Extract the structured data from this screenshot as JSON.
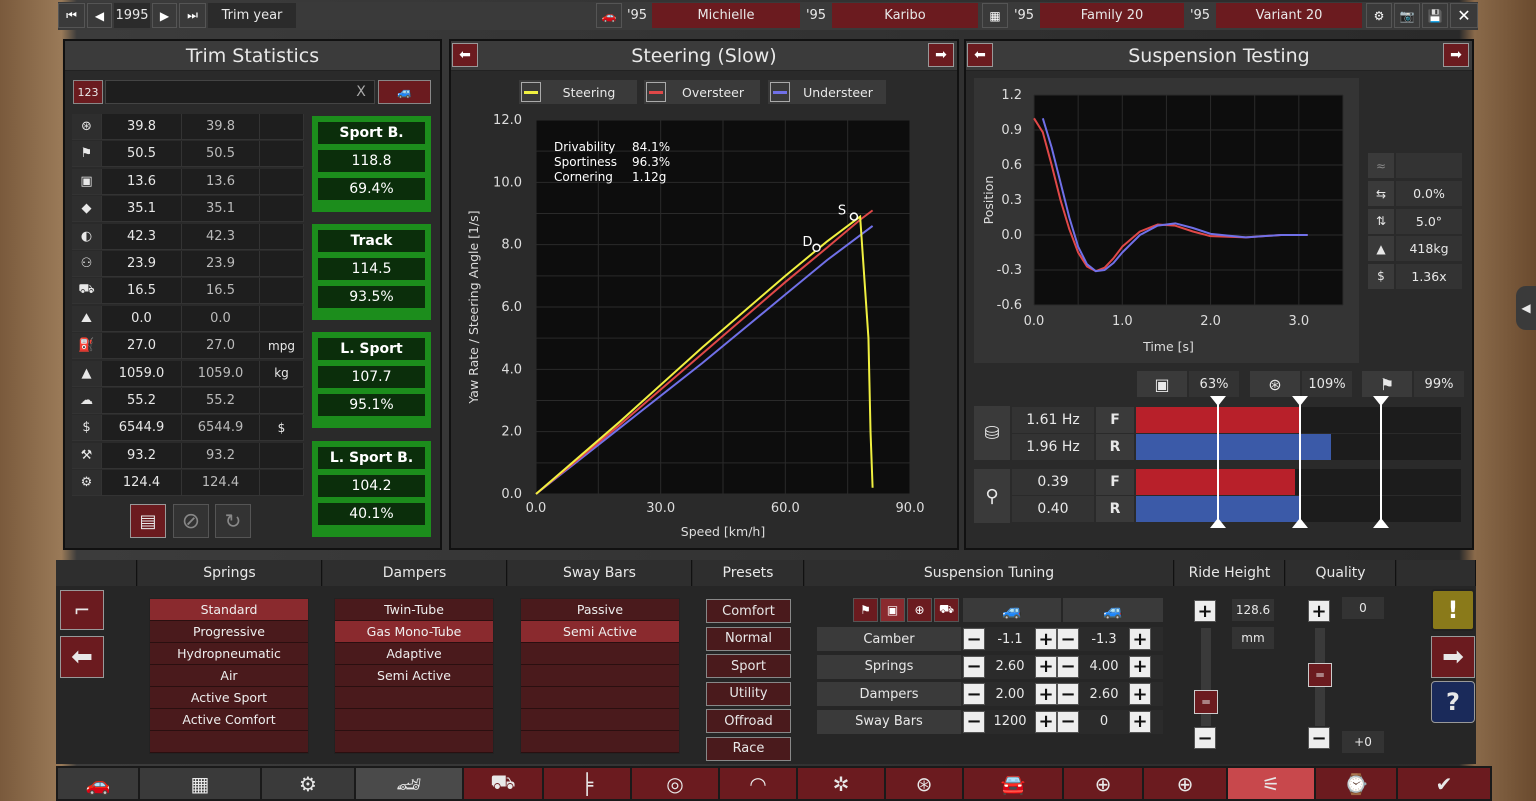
{
  "topbar": {
    "year": "1995",
    "trim_year_label": "Trim year",
    "models": [
      {
        "year": "'95",
        "name": "Michielle"
      },
      {
        "year": "'95",
        "name": "Karibo"
      }
    ],
    "families": [
      {
        "year": "'95",
        "name": "Family 20"
      },
      {
        "year": "'95",
        "name": "Variant 20"
      }
    ]
  },
  "trim_stats": {
    "title": "Trim Statistics",
    "search_icon_text": "123",
    "search_value": "",
    "clear_label": "X",
    "rows": [
      {
        "icon": "steering-wheel-icon",
        "a": "39.8",
        "b": "39.8",
        "unit": ""
      },
      {
        "icon": "checkered-flag-icon",
        "a": "50.5",
        "b": "50.5",
        "unit": ""
      },
      {
        "icon": "seat-icon",
        "a": "13.6",
        "b": "13.6",
        "unit": ""
      },
      {
        "icon": "gem-icon",
        "a": "35.1",
        "b": "35.1",
        "unit": ""
      },
      {
        "icon": "safety-icon",
        "a": "42.3",
        "b": "42.3",
        "unit": ""
      },
      {
        "icon": "people-icon",
        "a": "23.9",
        "b": "23.9",
        "unit": ""
      },
      {
        "icon": "truck-icon",
        "a": "16.5",
        "b": "16.5",
        "unit": ""
      },
      {
        "icon": "offroad-icon",
        "a": "0.0",
        "b": "0.0",
        "unit": ""
      },
      {
        "icon": "fuel-icon",
        "a": "27.0",
        "b": "27.0",
        "unit": "mpg"
      },
      {
        "icon": "weight-icon",
        "a": "1059.0",
        "b": "1059.0",
        "unit": "kg"
      },
      {
        "icon": "service-icon",
        "a": "55.2",
        "b": "55.2",
        "unit": ""
      },
      {
        "icon": "money-bag-icon",
        "a": "6544.9",
        "b": "6544.9",
        "unit": "$"
      },
      {
        "icon": "anvil-icon",
        "a": "93.2",
        "b": "93.2",
        "unit": ""
      },
      {
        "icon": "gear-wrench-icon",
        "a": "124.4",
        "b": "124.4",
        "unit": ""
      }
    ],
    "markets": [
      {
        "name": "Sport B.",
        "value": "118.8",
        "pct": "69.4%"
      },
      {
        "name": "Track",
        "value": "114.5",
        "pct": "93.5%"
      },
      {
        "name": "L. Sport",
        "value": "107.7",
        "pct": "95.1%"
      },
      {
        "name": "L. Sport B.",
        "value": "104.2",
        "pct": "40.1%"
      }
    ]
  },
  "steering": {
    "title": "Steering (Slow)",
    "legend": [
      "Steering",
      "Oversteer",
      "Understeer"
    ],
    "stats": [
      {
        "label": "Drivability",
        "value": "84.1%"
      },
      {
        "label": "Sportiness",
        "value": "96.3%"
      },
      {
        "label": "Cornering",
        "value": "1.12g"
      }
    ],
    "marker_d": "D",
    "marker_s": "S"
  },
  "suspension": {
    "title": "Suspension Testing",
    "side_stats": [
      {
        "icon": "roll-icon",
        "value": "0.0%"
      },
      {
        "icon": "pitch-icon",
        "value": "5.0°"
      },
      {
        "icon": "weight-icon",
        "value": "418kg"
      },
      {
        "icon": "cost-icon",
        "value": "1.36x"
      }
    ],
    "ratings": [
      {
        "icon": "comfort-icon",
        "value": "63%"
      },
      {
        "icon": "steering-wheel-icon",
        "value": "109%"
      },
      {
        "icon": "checkered-flag-icon",
        "value": "99%"
      }
    ],
    "freq": [
      {
        "value": "1.61 Hz",
        "axle": "F",
        "fill": 0.5
      },
      {
        "value": "1.96 Hz",
        "axle": "R",
        "fill": 0.6
      }
    ],
    "damp": [
      {
        "value": "0.39",
        "axle": "F",
        "fill": 0.49
      },
      {
        "value": "0.40",
        "axle": "R",
        "fill": 0.5
      }
    ]
  },
  "chart_data": [
    {
      "type": "line",
      "title": "Steering (Slow)",
      "xlabel": "Speed [km/h]",
      "ylabel": "Yaw Rate / Steering Angle [1/s]",
      "xlim": [
        0,
        90
      ],
      "ylim": [
        0,
        12
      ],
      "xticks": [
        "0.0",
        "30.0",
        "60.0",
        "90.0"
      ],
      "yticks": [
        "0.0",
        "2.0",
        "4.0",
        "6.0",
        "8.0",
        "10.0",
        "12.0"
      ],
      "series": [
        {
          "name": "Steering",
          "color": "#f0f040",
          "x": [
            0,
            20,
            40,
            60,
            70,
            77,
            78,
            80,
            80.5,
            81
          ],
          "y": [
            0,
            2.3,
            4.7,
            7.0,
            8.1,
            8.8,
            8.9,
            5.0,
            2.0,
            0.2
          ]
        },
        {
          "name": "Oversteer",
          "color": "#e04848",
          "x": [
            0,
            20,
            40,
            60,
            70,
            78,
            81
          ],
          "y": [
            0,
            2.2,
            4.5,
            6.8,
            7.9,
            8.8,
            9.1
          ]
        },
        {
          "name": "Understeer",
          "color": "#7070e8",
          "x": [
            0,
            20,
            40,
            60,
            70,
            78,
            81
          ],
          "y": [
            0,
            2.1,
            4.2,
            6.4,
            7.5,
            8.3,
            8.6
          ]
        }
      ]
    },
    {
      "type": "line",
      "xlabel": "Time [s]",
      "ylabel": "Position",
      "xlim": [
        0,
        3.5
      ],
      "ylim": [
        -0.6,
        1.2
      ],
      "xticks": [
        "0.0",
        "1.0",
        "2.0",
        "3.0"
      ],
      "yticks": [
        "1.2",
        "0.9",
        "0.6",
        "0.3",
        "0.0",
        "-0.3",
        "-0.6"
      ],
      "series": [
        {
          "color": "#e04848",
          "x": [
            0,
            0.1,
            0.2,
            0.3,
            0.4,
            0.5,
            0.6,
            0.7,
            0.8,
            0.9,
            1.0,
            1.2,
            1.4,
            1.6,
            1.8,
            2.0,
            2.4,
            2.8,
            3.1
          ],
          "y": [
            1.0,
            0.88,
            0.6,
            0.3,
            0.05,
            -0.15,
            -0.27,
            -0.31,
            -0.28,
            -0.2,
            -0.1,
            0.03,
            0.09,
            0.08,
            0.03,
            -0.01,
            -0.02,
            0.0,
            0.0
          ]
        },
        {
          "color": "#7070e8",
          "x": [
            0.1,
            0.2,
            0.3,
            0.4,
            0.5,
            0.6,
            0.7,
            0.8,
            0.9,
            1.0,
            1.2,
            1.4,
            1.6,
            1.8,
            2.0,
            2.4,
            2.8,
            3.1
          ],
          "y": [
            1.0,
            0.75,
            0.45,
            0.15,
            -0.1,
            -0.25,
            -0.31,
            -0.3,
            -0.24,
            -0.15,
            0.0,
            0.08,
            0.1,
            0.06,
            0.01,
            -0.02,
            0.0,
            0.0
          ]
        }
      ]
    }
  ],
  "tuning": {
    "headers": {
      "springs": "Springs",
      "dampers": "Dampers",
      "sway": "Sway Bars",
      "presets": "Presets",
      "tuning": "Suspension Tuning",
      "ride": "Ride Height",
      "quality": "Quality"
    },
    "springs": [
      "Standard",
      "Progressive",
      "Hydropneumatic",
      "Air",
      "Active Sport",
      "Active Comfort"
    ],
    "dampers": [
      "Twin-Tube",
      "Gas Mono-Tube",
      "Adaptive",
      "Semi Active"
    ],
    "sway": [
      "Passive",
      "Semi Active"
    ],
    "presets": [
      "Comfort",
      "Normal",
      "Sport",
      "Utility",
      "Offroad",
      "Race"
    ],
    "rows": [
      {
        "label": "Camber",
        "front": "-1.1",
        "rear": "-1.3"
      },
      {
        "label": "Springs",
        "front": "2.60",
        "rear": "4.00"
      },
      {
        "label": "Dampers",
        "front": "2.00",
        "rear": "2.60"
      },
      {
        "label": "Sway Bars",
        "front": "1200",
        "rear": "0"
      }
    ],
    "ride_height": "128.6",
    "ride_unit": "mm",
    "quality": "0",
    "quality_bonus": "+0"
  },
  "colors": {
    "accent": "#6b1b1f",
    "green": "#1c8d1c",
    "bar_red": "#b8202a",
    "bar_blue": "#3b5aa8"
  }
}
